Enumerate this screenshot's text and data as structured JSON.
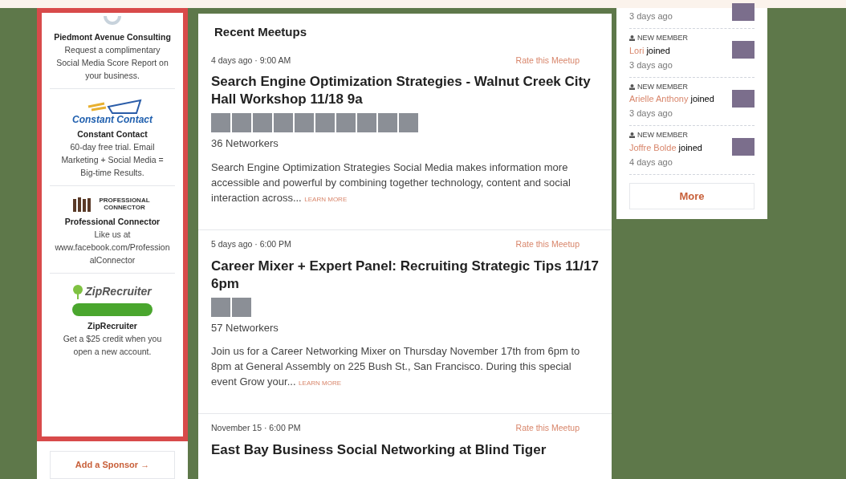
{
  "sponsors": [
    {
      "kind": "consulting",
      "name": "Piedmont Avenue Consulting",
      "description": "Request a complimentary Social Media Score Report on your business."
    },
    {
      "kind": "constant",
      "logo_text": "Constant Contact",
      "name": "Constant Contact",
      "description": "60-day free trial. Email Marketing + Social Media = Big-time Results."
    },
    {
      "kind": "connector",
      "logo_text": "PROFESSIONAL CONNECTOR",
      "name": "Professional Connector",
      "description": "Like us at www.facebook.com/ProfessionalConnector"
    },
    {
      "kind": "zip",
      "logo_text": "ZipRecruiter",
      "name": "ZipRecruiter",
      "description": "Get a $25 credit when you open a new account."
    }
  ],
  "add_sponsor": "Add a Sponsor →",
  "recent_meetups": {
    "title": "Recent Meetups",
    "items": [
      {
        "when": "4 days ago · 9:00 AM",
        "rate_link": "Rate this Meetup",
        "title": "Search Engine Optimization Strategies - Walnut Creek City Hall Workshop 11/18 9a",
        "attendee_photos": [
          {
            "kind": "photo"
          },
          {
            "kind": "photo"
          },
          {
            "kind": "photo"
          },
          {
            "kind": "photo"
          },
          {
            "kind": "photo"
          },
          {
            "kind": "photo"
          },
          {
            "kind": "photo"
          },
          {
            "kind": "photo"
          },
          {
            "kind": "photo"
          },
          {
            "kind": "photo"
          }
        ],
        "count": "36 Networkers",
        "description": "Search Engine Optimization Strategies Social Media makes information more accessible and powerful by combining together technology, content and social interaction across...",
        "learn_more": "LEARN MORE"
      },
      {
        "when": "5 days ago · 6:00 PM",
        "rate_link": "Rate this Meetup",
        "title": "Career Mixer + Expert Panel: Recruiting Strategic Tips 11/17 6pm",
        "attendee_photos": [
          {
            "kind": "photo"
          },
          {
            "kind": "photo"
          }
        ],
        "count": "57 Networkers",
        "description": "Join us for a Career Networking Mixer on Thursday November 17th from 6pm to 8pm at General Assembly on 225 Bush St., San Francisco. During this special event Grow your...",
        "learn_more": "LEARN MORE"
      },
      {
        "when": "November 15 · 6:00 PM",
        "rate_link": "Rate this Meetup",
        "title": "East Bay Business Social Networking at Blind Tiger"
      }
    ]
  },
  "activity": {
    "items": [
      {
        "time": "3 days ago"
      },
      {
        "label": "NEW MEMBER",
        "member": "Lori",
        "action": "joined",
        "time": "3 days ago"
      },
      {
        "label": "NEW MEMBER",
        "member": "Arielle Anthony",
        "action": "joined",
        "time": "3 days ago"
      },
      {
        "label": "NEW MEMBER",
        "member": "Joffre Bolde",
        "action": "joined",
        "time": "4 days ago"
      }
    ],
    "more": "More"
  }
}
